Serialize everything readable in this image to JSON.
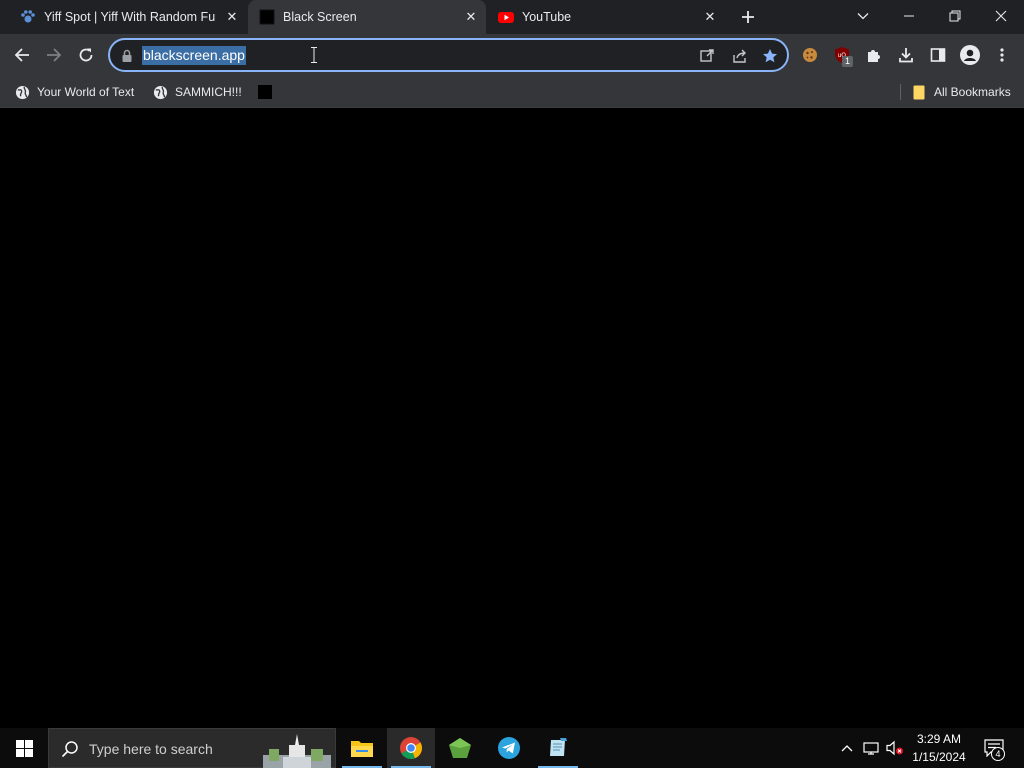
{
  "tabs": [
    {
      "title": "Yiff Spot | Yiff With Random Furries",
      "icon": "paw-icon",
      "active": false
    },
    {
      "title": "Black Screen",
      "icon": "black-square-icon",
      "active": true
    },
    {
      "title": "YouTube",
      "icon": "youtube-icon",
      "active": false
    }
  ],
  "toolbar": {
    "url": "blackscreen.app"
  },
  "bookmarks": [
    {
      "label": "Your World of Text",
      "icon": "globe-icon"
    },
    {
      "label": "SAMMICH!!!",
      "icon": "globe-icon"
    },
    {
      "label": "",
      "icon": "black-square-icon"
    }
  ],
  "bookmarks_folder": {
    "label": "All Bookmarks",
    "icon": "folder-icon"
  },
  "extensions": {
    "ublock_badge": "1"
  },
  "taskbar": {
    "search_placeholder": "Type here to search",
    "time": "3:29 AM",
    "date": "1/15/2024",
    "notification_count": "4"
  },
  "colors": {
    "accent": "#8ab4f8",
    "tab_strip": "#202124",
    "toolbar": "#35363a",
    "page_background": "#000000",
    "star": "#8ab4f8"
  }
}
